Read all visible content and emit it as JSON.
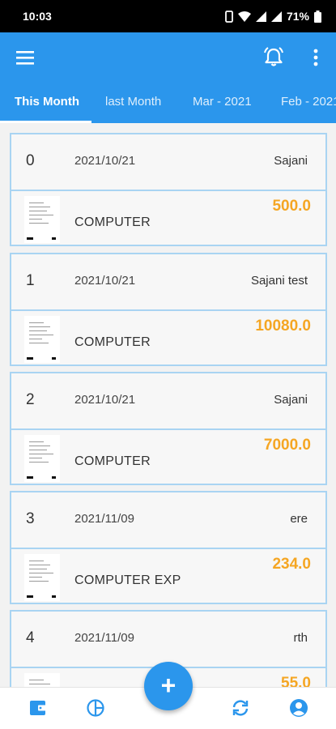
{
  "status": {
    "time": "10:03",
    "battery": "71%"
  },
  "tabs": [
    {
      "label": "This Month"
    },
    {
      "label": "last Month"
    },
    {
      "label": "Mar - 2021"
    },
    {
      "label": "Feb - 2021"
    }
  ],
  "expenses": [
    {
      "index": "0",
      "date": "2021/10/21",
      "user": "Sajani",
      "category": "COMPUTER",
      "amount": "500.0"
    },
    {
      "index": "1",
      "date": "2021/10/21",
      "user": "Sajani test",
      "category": "COMPUTER",
      "amount": "10080.0"
    },
    {
      "index": "2",
      "date": "2021/10/21",
      "user": "Sajani",
      "category": "COMPUTER",
      "amount": "7000.0"
    },
    {
      "index": "3",
      "date": "2021/11/09",
      "user": "ere",
      "category": "COMPUTER EXP",
      "amount": "234.0"
    },
    {
      "index": "4",
      "date": "2021/11/09",
      "user": "rth",
      "category": "",
      "amount": "55.0"
    }
  ],
  "fab": {
    "label": "+"
  },
  "colors": {
    "primary": "#2b96ec",
    "amount": "#f5a623",
    "card_border": "#a9d4f2"
  },
  "icons": {
    "app_bar": [
      "menu-icon",
      "alarm-bell-icon",
      "more-vert-icon"
    ],
    "bottom_nav": [
      "wallet-icon",
      "pie-chart-icon",
      "sync-icon",
      "account-icon"
    ]
  }
}
